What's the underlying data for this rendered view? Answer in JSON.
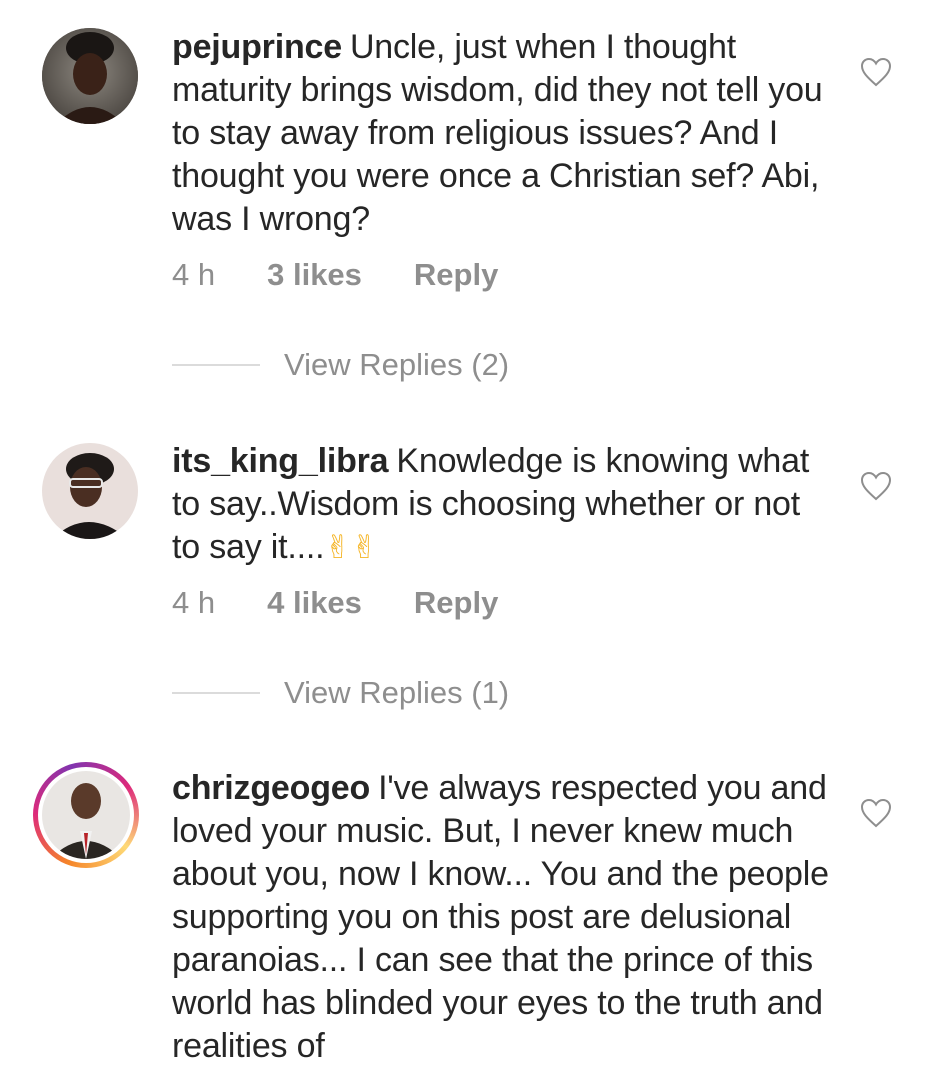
{
  "comments": [
    {
      "username": "pejuprince",
      "text": "Uncle, just when I thought maturity brings wisdom, did they not tell you to stay away from religious issues? And I thought you were once a Christian sef? Abi, was I wrong?",
      "time": "4 h",
      "likes": "3 likes",
      "reply": "Reply",
      "view_replies": "View Replies (2)"
    },
    {
      "username": "its_king_libra",
      "text": "Knowledge is knowing what to say..Wisdom is choosing whether or not to say it....",
      "emoji": "✌✌",
      "time": "4 h",
      "likes": "4 likes",
      "reply": "Reply",
      "view_replies": "View Replies (1)"
    },
    {
      "username": "chrizgeogeo",
      "text": "I've always respected you and loved your music. But, I never knew much about you, now I know... You and the people supporting you on this post are delusional paranoias... I can see that the prince of this world has blinded your eyes to the truth and realities of"
    }
  ],
  "icons": {
    "like": "heart-outline-icon",
    "emoji": "victory-hand-icon"
  },
  "colors": {
    "text": "#262626",
    "muted": "#8e8e8e",
    "divider": "#dbdbdb",
    "story_ring": "#dd2a7b"
  }
}
